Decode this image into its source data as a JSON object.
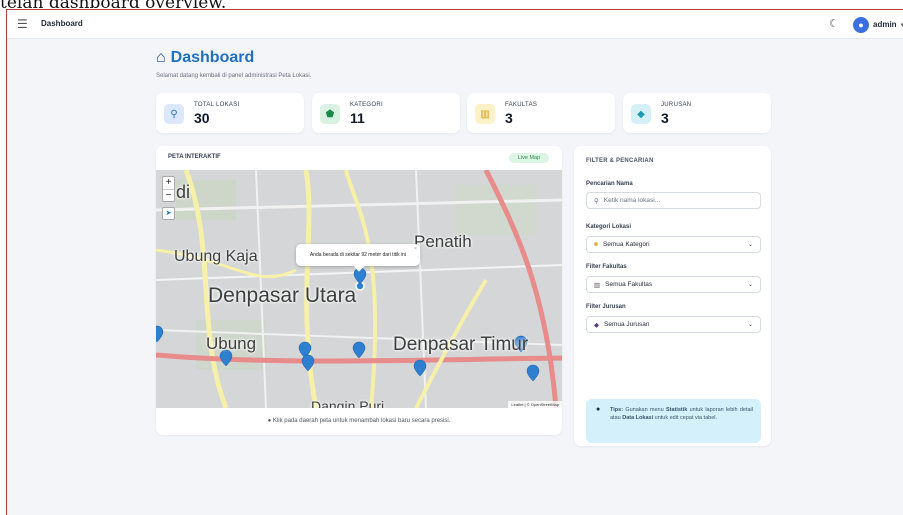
{
  "caption_top": "telah dashboard overview.",
  "navbar": {
    "brand": "Dashboard",
    "username": "admin"
  },
  "header": {
    "title": "Dashboard",
    "subtitle": "Selamat datang kembali di panel administrasi Peta Lokasi."
  },
  "stats": [
    {
      "label": "TOTAL LOKASI",
      "value": "30",
      "icon": "map-pin-icon",
      "bg": "#dbe7fb",
      "fg": "#2a6fd6"
    },
    {
      "label": "KATEGORI",
      "value": "11",
      "icon": "tag-icon",
      "bg": "#d9f2e3",
      "fg": "#1e8a4a"
    },
    {
      "label": "FAKULTAS",
      "value": "3",
      "icon": "bank-icon",
      "bg": "#fdf1c7",
      "fg": "#d49b0c"
    },
    {
      "label": "JURUSAN",
      "value": "3",
      "icon": "graduation-cap-icon",
      "bg": "#d5f1f7",
      "fg": "#1a9ab8"
    }
  ],
  "map": {
    "title": "PETA INTERAKTIF",
    "badge": "Live Map",
    "popup": "Anda berada di sekitar 92 meter dari titik ini",
    "labels": {
      "l1": "di",
      "l2": "Penatih",
      "l3": "Ubung Kaja",
      "l4": "Denpasar Utara",
      "l5": "Ubung",
      "l6": "Denpasar Timur",
      "l7": "Dangin Puri"
    },
    "attribution": "Leaflet | © OpenStreetMap",
    "note": "Klik pada daerah peta untuk menambah lokasi baru secara presisi."
  },
  "filter": {
    "title": "FILTER & PENCARIAN",
    "search_label": "Pencarian Nama",
    "search_placeholder": "Ketik nama lokasi...",
    "kategori_label": "Kategori Lokasi",
    "kategori_value": "Semua Kategori",
    "fakultas_label": "Filter Fakultas",
    "fakultas_value": "Semua Fakultas",
    "jurusan_label": "Filter Jurusan",
    "jurusan_value": "Semua Jurusan",
    "tips": {
      "prefix": "Tips:",
      "text1": " Gunakan menu ",
      "b1": "Statistik",
      "text2": " untuk laporan lebih detail atau ",
      "b2": "Data Lokasi",
      "text3": " untuk edit cepat via tabel."
    }
  }
}
